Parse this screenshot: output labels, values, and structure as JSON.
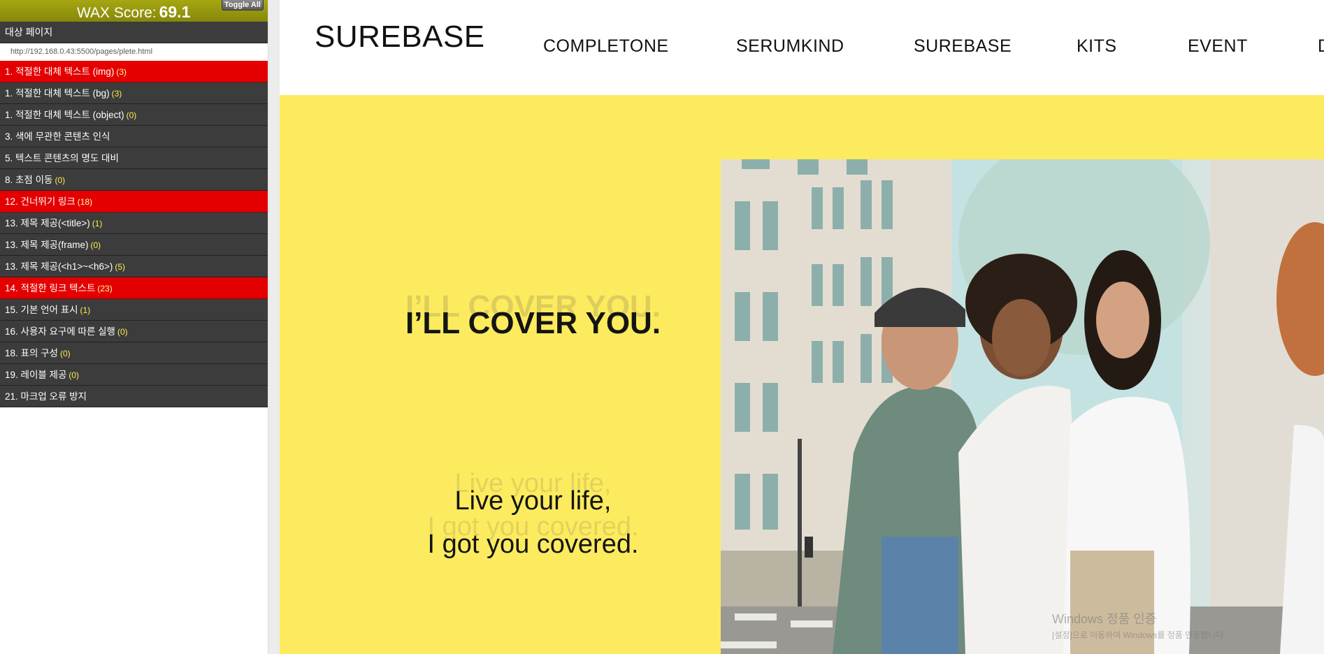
{
  "wax": {
    "score_label": "WAX Score:",
    "score_value": "69.1",
    "toggle_label": "Toggle All",
    "target_label": "대상 페이지",
    "target_url": "http://192.168.0.43:5500/pages/plete.html",
    "items": [
      {
        "label": "1. 적절한 대체 텍스트 (img)",
        "count": "(3)",
        "status": "error"
      },
      {
        "label": "1. 적절한 대체 텍스트 (bg)",
        "count": "(3)",
        "status": "normal"
      },
      {
        "label": "1. 적절한 대체 텍스트 (object)",
        "count": "(0)",
        "status": "normal"
      },
      {
        "label": "3. 색에 무관한 콘텐츠 인식",
        "count": "",
        "status": "normal"
      },
      {
        "label": "5. 텍스트 콘텐츠의 명도 대비",
        "count": "",
        "status": "normal"
      },
      {
        "label": "8. 초점 이동",
        "count": "(0)",
        "status": "normal"
      },
      {
        "label": "12. 건너뛰기 링크",
        "count": "(18)",
        "status": "error"
      },
      {
        "label": "13. 제목 제공(<title>)",
        "count": "(1)",
        "status": "normal"
      },
      {
        "label": "13. 제목 제공(frame)",
        "count": "(0)",
        "status": "normal"
      },
      {
        "label": "13. 제목 제공(<h1>~<h6>)",
        "count": "(5)",
        "status": "normal"
      },
      {
        "label": "14. 적절한 링크 텍스트",
        "count": "(23)",
        "status": "error"
      },
      {
        "label": "15. 기본 언어 표시",
        "count": "(1)",
        "status": "normal"
      },
      {
        "label": "16. 사용자 요구에 따른 실행",
        "count": "(0)",
        "status": "normal"
      },
      {
        "label": "18. 표의 구성",
        "count": "(0)",
        "status": "normal"
      },
      {
        "label": "19. 레이블 제공",
        "count": "(0)",
        "status": "normal"
      },
      {
        "label": "21. 마크업 오류 방지",
        "count": "",
        "status": "normal"
      }
    ]
  },
  "site": {
    "logo": "SUREBASE",
    "nav": [
      "COMPLETONE",
      "SERUMKIND",
      "SUREBASE",
      "KITS",
      "EVENT",
      "D"
    ],
    "hero": {
      "title": "I’LL COVER YOU.",
      "subtitle_line1": "Live your life,",
      "subtitle_line2": "I got you covered."
    }
  },
  "windows_watermark": {
    "line1": "Windows 정품 인증",
    "line2": "[설정]으로 이동하여 Windows를 정품 인증합니다."
  },
  "colors": {
    "wax_header": "#a6a712",
    "wax_item": "#3c3c3c",
    "wax_error": "#e40000",
    "hero_bg": "#fdeb5f"
  }
}
